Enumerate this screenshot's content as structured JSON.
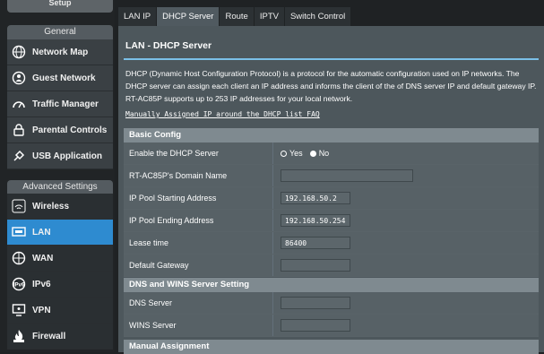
{
  "sidebar": {
    "top_label": "Setup",
    "general_header": "General",
    "general_items": [
      {
        "label": "Network Map",
        "icon": "globe-icon"
      },
      {
        "label": "Guest Network",
        "icon": "globe-people-icon"
      },
      {
        "label": "Traffic Manager",
        "icon": "gauge-icon"
      },
      {
        "label": "Parental Controls",
        "icon": "lock-icon"
      },
      {
        "label": "USB Application",
        "icon": "puzzle-icon"
      }
    ],
    "advanced_header": "Advanced Settings",
    "advanced_items": [
      {
        "label": "Wireless",
        "icon": "wifi-icon"
      },
      {
        "label": "LAN",
        "icon": "lan-icon",
        "active": true
      },
      {
        "label": "WAN",
        "icon": "world-icon"
      },
      {
        "label": "IPv6",
        "icon": "ipv6-icon"
      },
      {
        "label": "VPN",
        "icon": "vpn-monitor-icon"
      },
      {
        "label": "Firewall",
        "icon": "firewall-icon"
      }
    ]
  },
  "tabs": [
    "LAN IP",
    "DHCP Server",
    "Route",
    "IPTV",
    "Switch Control"
  ],
  "active_tab": "DHCP Server",
  "page": {
    "title": "LAN - DHCP Server",
    "description": "DHCP (Dynamic Host Configuration Protocol) is a protocol for the automatic configuration used on IP networks. The DHCP server can assign each client an IP address and informs the client of the of DNS server IP and default gateway IP. RT-AC85P supports up to 253 IP addresses for your local network.",
    "faq_link": "Manually Assigned IP around the DHCP list FAQ"
  },
  "basic_config": {
    "header": "Basic Config",
    "enable_label": "Enable the DHCP Server",
    "enable_yes": "Yes",
    "enable_no": "No",
    "enable_value": "Yes",
    "domain_label": "RT-AC85P's Domain Name",
    "domain_value": "",
    "start_label": "IP Pool Starting Address",
    "start_value": "192.168.50.2",
    "end_label": "IP Pool Ending Address",
    "end_value": "192.168.50.254",
    "lease_label": "Lease time",
    "lease_value": "86400",
    "gateway_label": "Default Gateway",
    "gateway_value": ""
  },
  "dns_wins": {
    "header": "DNS and WINS Server Setting",
    "dns_label": "DNS Server",
    "dns_value": "",
    "wins_label": "WINS Server",
    "wins_value": ""
  },
  "manual": {
    "header": "Manual Assignment"
  },
  "colors": {
    "accent": "#2e8bd0",
    "divider": "#7bc0e8",
    "panel": "#4d575c",
    "table_header": "#7f8a90"
  }
}
